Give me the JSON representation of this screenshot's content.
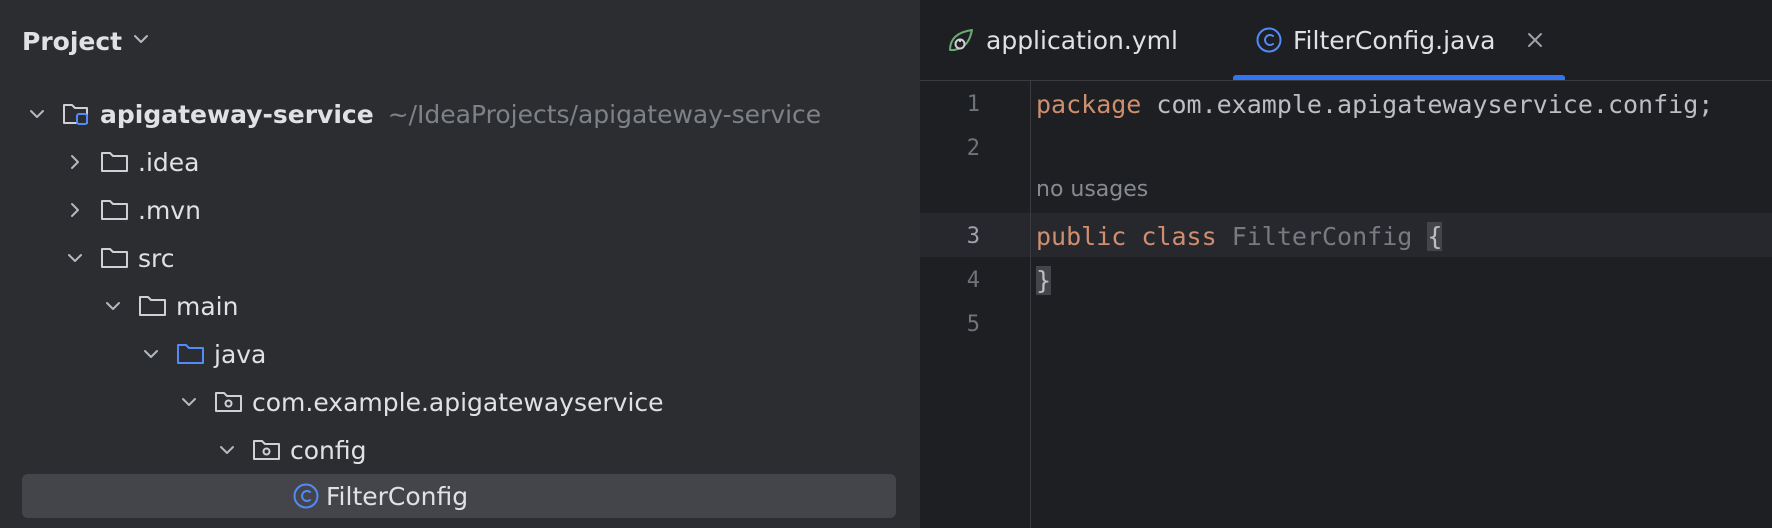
{
  "project_panel": {
    "title": "Project",
    "tree": [
      {
        "label": "apigateway-service",
        "path": "~/IdeaProjects/apigateway-service",
        "expanded": true,
        "icon": "module-folder-icon",
        "bold": true
      },
      {
        "label": ".idea",
        "expanded": false,
        "icon": "folder-icon"
      },
      {
        "label": ".mvn",
        "expanded": false,
        "icon": "folder-icon"
      },
      {
        "label": "src",
        "expanded": true,
        "icon": "folder-icon"
      },
      {
        "label": "main",
        "expanded": true,
        "icon": "folder-icon"
      },
      {
        "label": "java",
        "expanded": true,
        "icon": "source-folder-icon"
      },
      {
        "label": "com.example.apigatewayservice",
        "expanded": true,
        "icon": "package-icon"
      },
      {
        "label": "config",
        "expanded": true,
        "icon": "package-icon"
      },
      {
        "label": "FilterConfig",
        "icon": "class-icon",
        "selected": true
      }
    ]
  },
  "editor": {
    "tabs": [
      {
        "label": "application.yml",
        "icon": "spring-config-icon",
        "active": false
      },
      {
        "label": "FilterConfig.java",
        "icon": "class-icon",
        "active": true
      }
    ],
    "line_numbers": [
      "1",
      "2",
      "3",
      "4",
      "5"
    ],
    "code": {
      "line1_keyword": "package",
      "line1_rest": " com.example.apigatewayservice.config;",
      "usage_hint": "no usages",
      "line3_kw1": "public",
      "line3_kw2": "class",
      "line3_classname": "FilterConfig",
      "line3_brace": "{",
      "line4_brace": "}"
    }
  },
  "colors": {
    "accent": "#3574f0",
    "keyword": "#cf8e6d",
    "panel_bg": "#2b2d30",
    "editor_bg": "#1e1f22"
  }
}
